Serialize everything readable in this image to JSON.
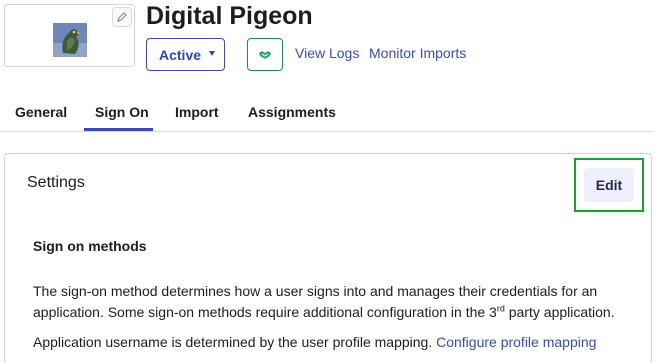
{
  "app": {
    "title": "Digital Pigeon",
    "logo_icon": "pigeon-logo-icon",
    "edit_logo_icon": "pencil-icon"
  },
  "status": {
    "label": "Active",
    "caret_icon": "caret-down-icon"
  },
  "push_button": {
    "icon": "handshake-icon",
    "color": "#1e8a58"
  },
  "links": {
    "view_logs": "View Logs",
    "monitor_imports": "Monitor Imports"
  },
  "tabs": [
    {
      "label": "General",
      "active": false
    },
    {
      "label": "Sign On",
      "active": true
    },
    {
      "label": "Import",
      "active": false
    },
    {
      "label": "Assignments",
      "active": false
    }
  ],
  "settings": {
    "title": "Settings",
    "edit_label": "Edit",
    "sign_on_title": "Sign on methods",
    "description_part1": "The sign-on method determines how a user signs into and manages their credentials for an application. Some sign-on methods require additional configuration in the 3",
    "description_sup": "rd",
    "description_part2": " party application.",
    "username_text": "Application username is determined by the user profile mapping. ",
    "username_link": "Configure profile mapping"
  },
  "colors": {
    "accent": "#3d48b3",
    "link": "#3b4bbd",
    "highlight_border": "#14a52e"
  }
}
